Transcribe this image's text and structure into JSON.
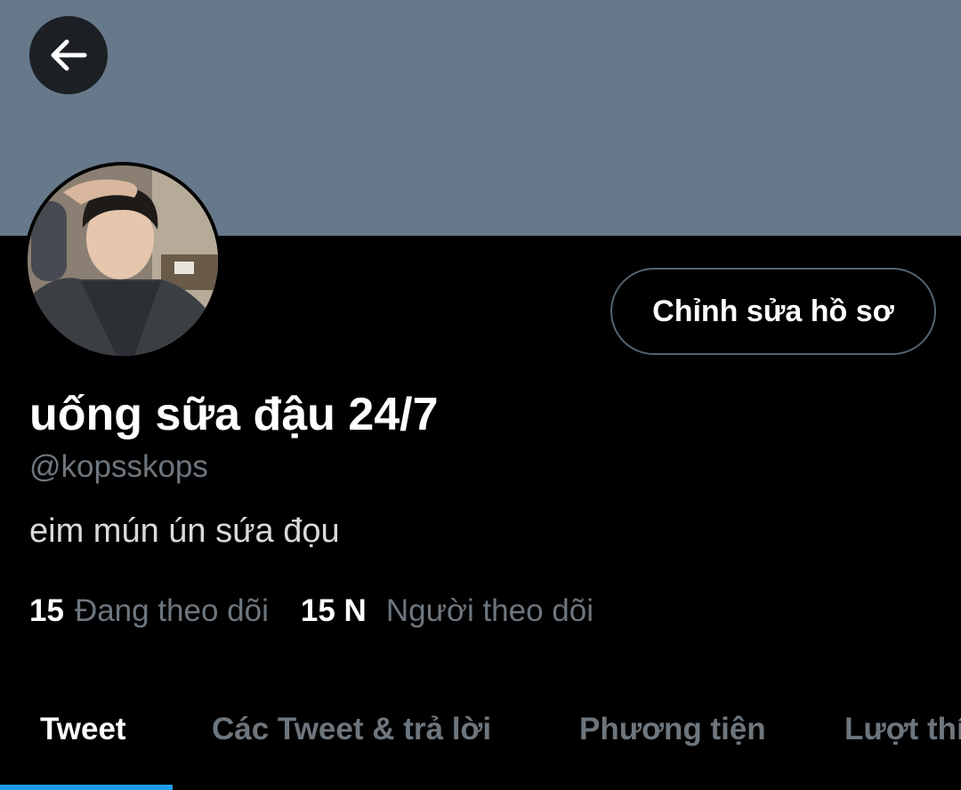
{
  "header": {
    "back_icon": "arrow-left-icon",
    "banner_color": "#66788a"
  },
  "profile": {
    "display_name": "uống sữa đậu 24/7",
    "handle": "@kopsskops",
    "bio": "eim mún ún sứa đọu",
    "edit_button_label": "Chỉnh sửa hồ sơ"
  },
  "stats": {
    "following_count": "15",
    "following_label": "Đang theo dõi",
    "followers_count": "15 N",
    "followers_label": "Người theo dõi"
  },
  "tabs": [
    {
      "label": "Tweet",
      "active": true
    },
    {
      "label": "Các Tweet & trả lời",
      "active": false
    },
    {
      "label": "Phương tiện",
      "active": false
    },
    {
      "label": "Lượt thích",
      "active": false
    }
  ],
  "colors": {
    "background": "#000000",
    "accent": "#1d9bf0",
    "secondary_text": "#6e767d"
  }
}
